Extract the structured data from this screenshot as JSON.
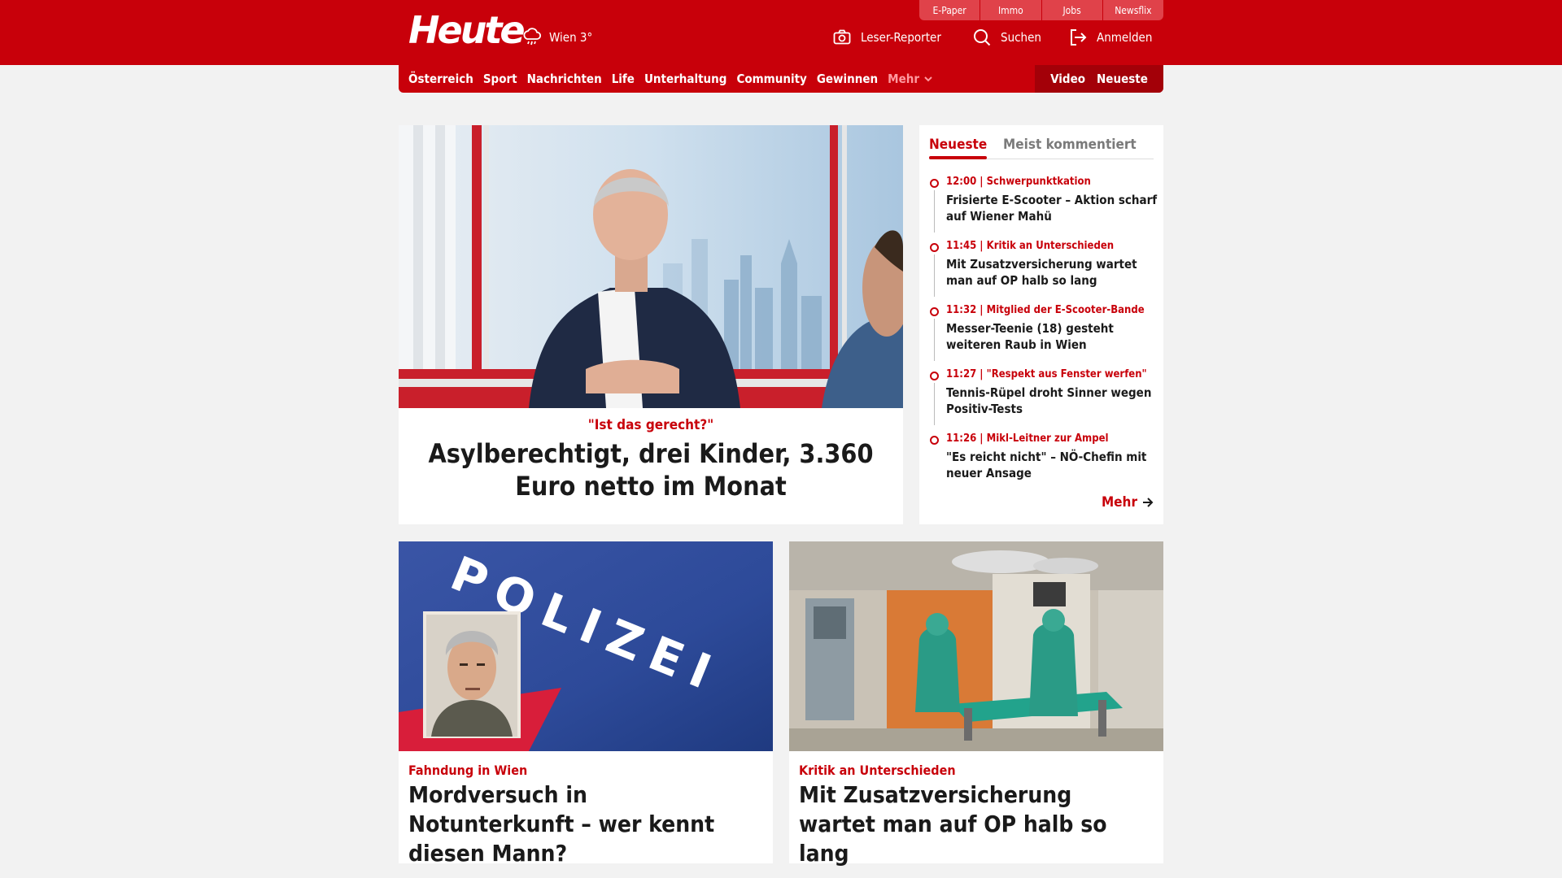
{
  "header": {
    "logo": "Heute",
    "weather": "Wien 3°",
    "service_tabs": [
      "E-Paper",
      "Immo",
      "Jobs",
      "Newsflix"
    ],
    "reporter": "Leser-Reporter",
    "search": "Suchen",
    "login": "Anmelden"
  },
  "nav": {
    "items": [
      "Österreich",
      "Sport",
      "Nachrichten",
      "Life",
      "Unterhaltung",
      "Community",
      "Gewinnen"
    ],
    "more": "Mehr",
    "video": "Video",
    "latest": "Neueste"
  },
  "hero": {
    "kicker": "\"Ist das gerecht?\"",
    "title": "Asylberechtigt, drei Kinder, 3.360 Euro netto im Monat"
  },
  "sidebar": {
    "tab_active": "Neueste",
    "tab_other": "Meist kommentiert",
    "items": [
      {
        "kicker": "12:00 | Schwerpunktkation",
        "title": "Frisierte E-Scooter – Aktion scharf auf Wiener Mahü"
      },
      {
        "kicker": "11:45 | Kritik an Unterschieden",
        "title": "Mit Zusatzversicherung wartet man auf OP halb so lang"
      },
      {
        "kicker": "11:32 | Mitglied der E-Scooter-Bande",
        "title": "Messer-Teenie (18) gesteht weiteren Raub in Wien"
      },
      {
        "kicker": "11:27 | \"Respekt aus Fenster werfen\"",
        "title": "Tennis-Rüpel droht Sinner wegen Positiv-Tests"
      },
      {
        "kicker": "11:26 | Mikl-Leitner zur Ampel",
        "title": "\"Es reicht nicht\" – NÖ-Chefin mit neuer Ansage"
      }
    ],
    "more": "Mehr"
  },
  "cards": [
    {
      "kicker": "Fahndung in Wien",
      "title": "Mordversuch in Notunterkunft – wer kennt diesen Mann?",
      "image_text": "POLIZEI"
    },
    {
      "kicker": "Kritik an Unterschieden",
      "title": "Mit Zusatzversicherung wartet man auf OP halb so lang"
    }
  ],
  "colors": {
    "brand_red": "#c8000a",
    "background": "#f2f2f2"
  }
}
